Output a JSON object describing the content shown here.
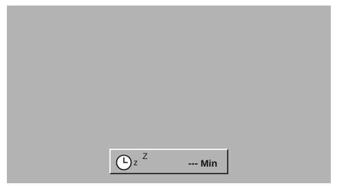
{
  "screen": {
    "background_color": "#b3b3b3"
  },
  "sleep_timer": {
    "icon": "clock-icon",
    "sleep_symbol_1": "z",
    "sleep_symbol_2": "Z",
    "value": "--- Min"
  }
}
